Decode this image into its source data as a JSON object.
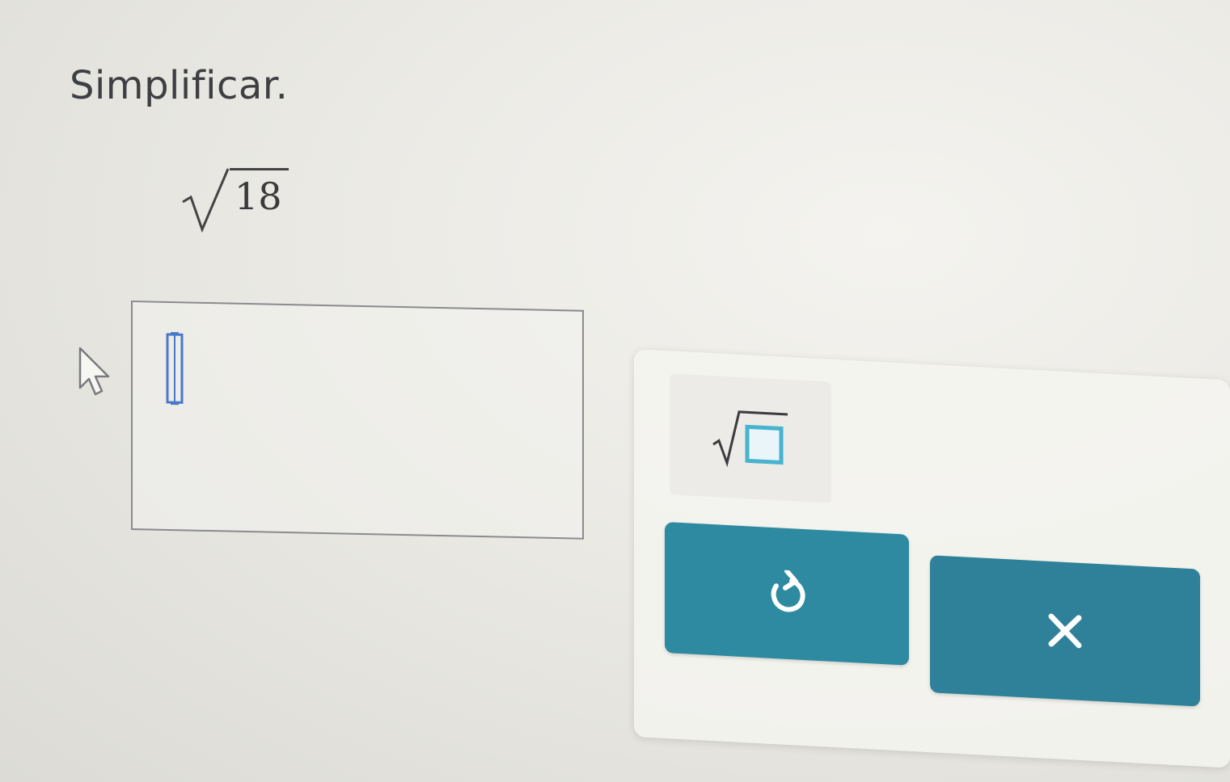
{
  "prompt": {
    "text": "Simplificar."
  },
  "problem": {
    "radical_icon": "square-root-symbol",
    "radicand": "18"
  },
  "answer": {
    "value": "",
    "cursor_icon": "text-cursor-icon"
  },
  "palette": {
    "sqrt_key_icon": "square-root-template-icon",
    "undo_icon": "undo-icon",
    "clear_icon": "close-icon"
  },
  "colors": {
    "accent": "#2e8aa0",
    "box_outline": "#8b8b8e",
    "cursor": "#4a78c8",
    "template_outline": "#47b3cf"
  }
}
